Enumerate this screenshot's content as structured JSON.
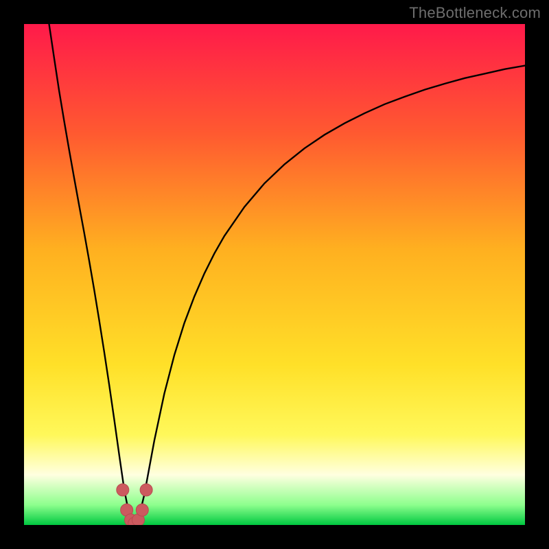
{
  "watermark": "TheBottleneck.com",
  "colors": {
    "frame": "#000000",
    "gradient_top": "#ff1a4a",
    "gradient_mid_upper": "#ff6a2a",
    "gradient_mid": "#ffb020",
    "gradient_mid_lower": "#ffe028",
    "gradient_lower": "#fff85a",
    "gradient_pale": "#ffffe0",
    "gradient_green": "#00e850",
    "gradient_green_deep": "#00c840",
    "curve": "#000000",
    "marker_fill": "#cc5a5f",
    "marker_stroke": "#b94a50"
  },
  "chart_data": {
    "type": "line",
    "title": "",
    "xlabel": "",
    "ylabel": "",
    "xlim": [
      0,
      100
    ],
    "ylim": [
      0,
      100
    ],
    "x_minimum": 22,
    "series": [
      {
        "name": "bottleneck-curve",
        "x": [
          5,
          6,
          7,
          8,
          9,
          10,
          11,
          12,
          13,
          14,
          15,
          16,
          17,
          18,
          19,
          20,
          21,
          22,
          23,
          24,
          25,
          26,
          28,
          30,
          32,
          34,
          36,
          38,
          40,
          44,
          48,
          52,
          56,
          60,
          64,
          68,
          72,
          76,
          80,
          84,
          88,
          92,
          96,
          100
        ],
        "y": [
          100,
          93.3,
          86.7,
          80.7,
          74.9,
          69.3,
          63.8,
          58.4,
          52.8,
          47.0,
          40.9,
          34.6,
          28.0,
          21.1,
          14.0,
          7.1,
          2.0,
          0.0,
          1.8,
          6.0,
          11.4,
          16.8,
          26.2,
          33.9,
          40.3,
          45.6,
          50.2,
          54.2,
          57.7,
          63.5,
          68.2,
          72.0,
          75.2,
          77.9,
          80.2,
          82.2,
          84.0,
          85.5,
          86.9,
          88.1,
          89.2,
          90.1,
          91.0,
          91.7
        ]
      }
    ],
    "markers": {
      "name": "highlight-points",
      "x": [
        19.7,
        20.5,
        21.3,
        22.0,
        22.8,
        23.6,
        24.4
      ],
      "y": [
        7.0,
        3.0,
        1.0,
        0.3,
        1.0,
        3.0,
        7.0
      ]
    }
  }
}
